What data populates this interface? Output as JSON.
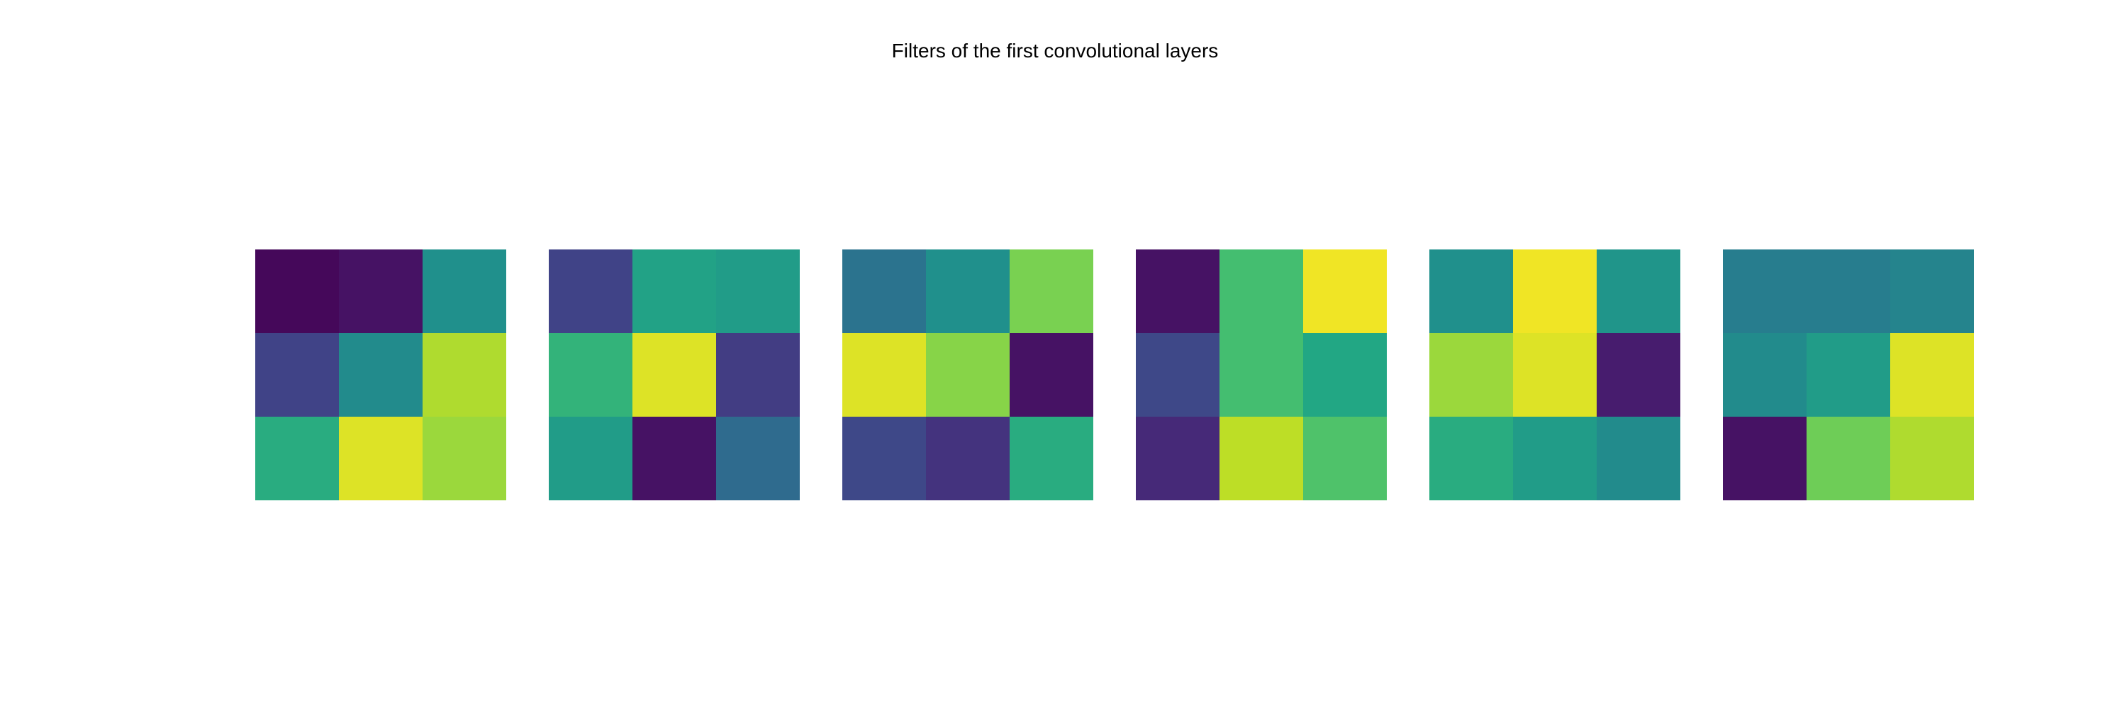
{
  "title": "Filters of the first convolutional layers",
  "chart_data": [
    {
      "type": "heatmap",
      "rows": 3,
      "cols": 3,
      "values": [
        [
          0.02,
          0.05,
          0.5
        ],
        [
          0.2,
          0.48,
          0.88
        ],
        [
          0.62,
          0.95,
          0.85
        ]
      ],
      "colormap": "viridis"
    },
    {
      "type": "heatmap",
      "rows": 3,
      "cols": 3,
      "values": [
        [
          0.2,
          0.58,
          0.55
        ],
        [
          0.65,
          0.95,
          0.18
        ],
        [
          0.55,
          0.05,
          0.35
        ]
      ],
      "colormap": "viridis"
    },
    {
      "type": "heatmap",
      "rows": 3,
      "cols": 3,
      "values": [
        [
          0.38,
          0.5,
          0.8
        ],
        [
          0.95,
          0.82,
          0.05
        ],
        [
          0.22,
          0.15,
          0.62
        ]
      ],
      "colormap": "viridis"
    },
    {
      "type": "heatmap",
      "rows": 3,
      "cols": 3,
      "values": [
        [
          0.05,
          0.7,
          0.98
        ],
        [
          0.22,
          0.7,
          0.6
        ],
        [
          0.12,
          0.9,
          0.72
        ]
      ],
      "colormap": "viridis"
    },
    {
      "type": "heatmap",
      "rows": 3,
      "cols": 3,
      "values": [
        [
          0.5,
          0.98,
          0.52
        ],
        [
          0.85,
          0.95,
          0.08
        ],
        [
          0.62,
          0.55,
          0.48
        ]
      ],
      "colormap": "viridis"
    },
    {
      "type": "heatmap",
      "rows": 3,
      "cols": 3,
      "values": [
        [
          0.42,
          0.42,
          0.45
        ],
        [
          0.48,
          0.55,
          0.95
        ],
        [
          0.05,
          0.78,
          0.88
        ]
      ],
      "colormap": "viridis"
    }
  ]
}
